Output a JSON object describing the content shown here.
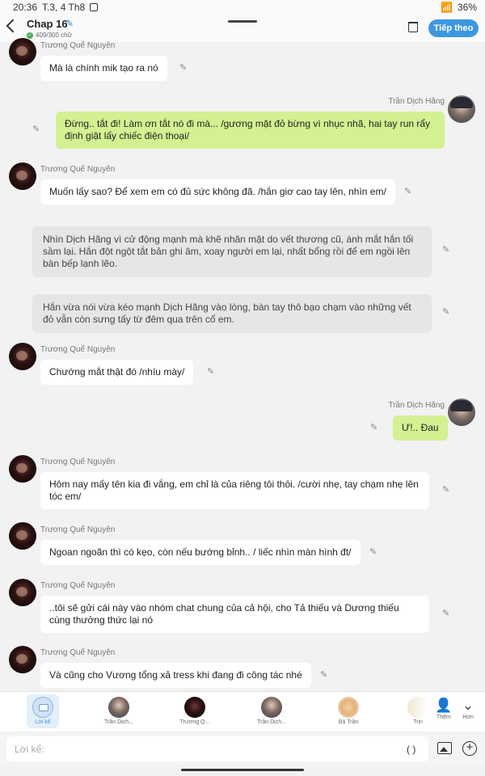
{
  "status": {
    "time": "20:36",
    "date": "T.3, 4 Th8",
    "battery": "36%"
  },
  "header": {
    "title": "Chap 16",
    "word_count": "409/300 chữ",
    "follow_label": "Tiếp theo"
  },
  "messages": [
    {
      "name": "Trương Quế Nguyên",
      "text": "Mà là chính mik tạo ra nó"
    },
    {
      "name": "Trần Dịch Hãng",
      "text": "Đừng.. tắt đi! Làm ơn tắt nó đi mà... /gương mặt đỏ bừng vì nhục nhã, hai tay run rẩy định giật lấy chiếc điện thoại/"
    },
    {
      "name": "Trương Quế Nguyên",
      "text": "Muốn lấy sao? Để xem em có đủ sức không đã. /hắn giơ cao tay lên, nhìn em/"
    },
    {
      "name": "",
      "text": "Nhìn Dịch Hãng vì cử động mạnh mà khẽ nhăn mặt do vết thương cũ, ánh mắt hắn tối sầm lại. Hắn đột ngột tắt bản ghi âm, xoay người em lại, nhất bổng rồi để em ngồi lên bàn bếp lạnh lẽo."
    },
    {
      "name": "",
      "text": "Hắn vừa nói vừa kéo mạnh Dịch Hãng vào lòng, bàn tay thô bạo chạm vào những vết đỏ vẫn còn sưng tấy từ đêm qua trên cổ em."
    },
    {
      "name": "Trương Quế Nguyên",
      "text": "Chướng mắt thật đó /nhíu mày/"
    },
    {
      "name": "Trần Dịch Hãng",
      "text": "Ư!.. Đau"
    },
    {
      "name": "Trương Quế Nguyên",
      "text": "Hôm nay mấy tên kia đi vắng, em chỉ là của riêng tôi thôi. /cười nhẹ, tay chạm nhẹ lên tóc em/"
    },
    {
      "name": "Trương Quế Nguyên",
      "text": "Ngoan ngoãn thì có kẹo, còn nếu bướng bỉnh.. / liếc nhìn màn hình đt/"
    },
    {
      "name": "Trương Quế Nguyên",
      "text": "..tôi sẽ gửi cái này vào nhóm chat chung của cả hội, cho Tả thiếu và Dương thiếu cùng thưởng thức lại nó"
    },
    {
      "name": "Trương Quế Nguyên",
      "text": "Và cũng cho Vương tổng xả tress khi đang đi công tác nhé"
    }
  ],
  "characters": [
    {
      "label": "Lời kể"
    },
    {
      "label": "Trần Dịch..."
    },
    {
      "label": "Trương Q..."
    },
    {
      "label": "Trần Dịch..."
    },
    {
      "label": "Bà Trần"
    },
    {
      "label": "Trịn"
    }
  ],
  "actions": {
    "add_label": "Thêm",
    "more_label": "Hơn"
  },
  "input": {
    "placeholder": "Lời kể:",
    "paren": "( )"
  }
}
